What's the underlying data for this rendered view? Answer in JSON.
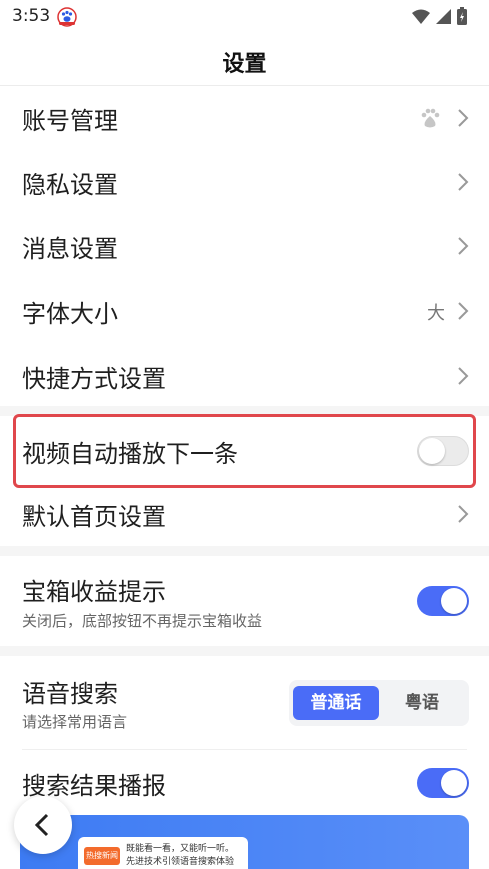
{
  "status_bar": {
    "time": "3:53"
  },
  "nav": {
    "title": "设置"
  },
  "rows": {
    "account": {
      "label": "账号管理"
    },
    "privacy": {
      "label": "隐私设置"
    },
    "message": {
      "label": "消息设置"
    },
    "font": {
      "label": "字体大小",
      "value": "大"
    },
    "shortcut": {
      "label": "快捷方式设置"
    },
    "autoplay": {
      "label": "视频自动播放下一条",
      "enabled": false
    },
    "homepage": {
      "label": "默认首页设置"
    },
    "treasure": {
      "label": "宝箱收益提示",
      "subtitle": "关闭后，底部按钮不再提示宝箱收益",
      "enabled": true
    },
    "voice": {
      "label": "语音搜索",
      "subtitle": "请选择常用语言",
      "options": [
        "普通话",
        "粤语"
      ],
      "selected": "普通话"
    },
    "broadcast": {
      "label": "搜索结果播报",
      "enabled": true
    }
  },
  "banner": {
    "chip": "热搜新闻",
    "text_line1": "既能看一看，又能听一听。",
    "text_line2": "先进技术引领语音搜索体验"
  },
  "colors": {
    "accent": "#4a6cf7",
    "highlight": "#e0474c"
  }
}
